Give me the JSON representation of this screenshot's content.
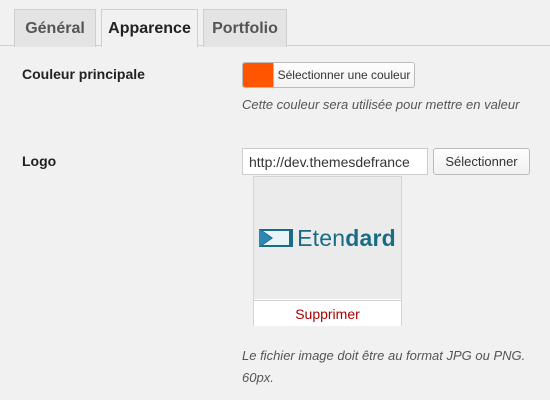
{
  "tabs": [
    {
      "label": "Général",
      "active": false
    },
    {
      "label": "Apparence",
      "active": true
    },
    {
      "label": "Portfolio",
      "active": false
    }
  ],
  "color_field": {
    "label": "Couleur principale",
    "swatch_color": "#ff5500",
    "button_label": "Sélectionner une couleur",
    "description": "Cette couleur sera utilisée pour mettre en valeur"
  },
  "logo_field": {
    "label": "Logo",
    "url_value": "http://dev.themesdefrance",
    "select_label": "Sélectionner",
    "preview_logo_text_prefix": "Eten",
    "preview_logo_text_bold": "dard",
    "remove_label": "Supprimer",
    "description_line1": "Le fichier image doit être au format JPG ou PNG.",
    "description_line2": "60px."
  }
}
